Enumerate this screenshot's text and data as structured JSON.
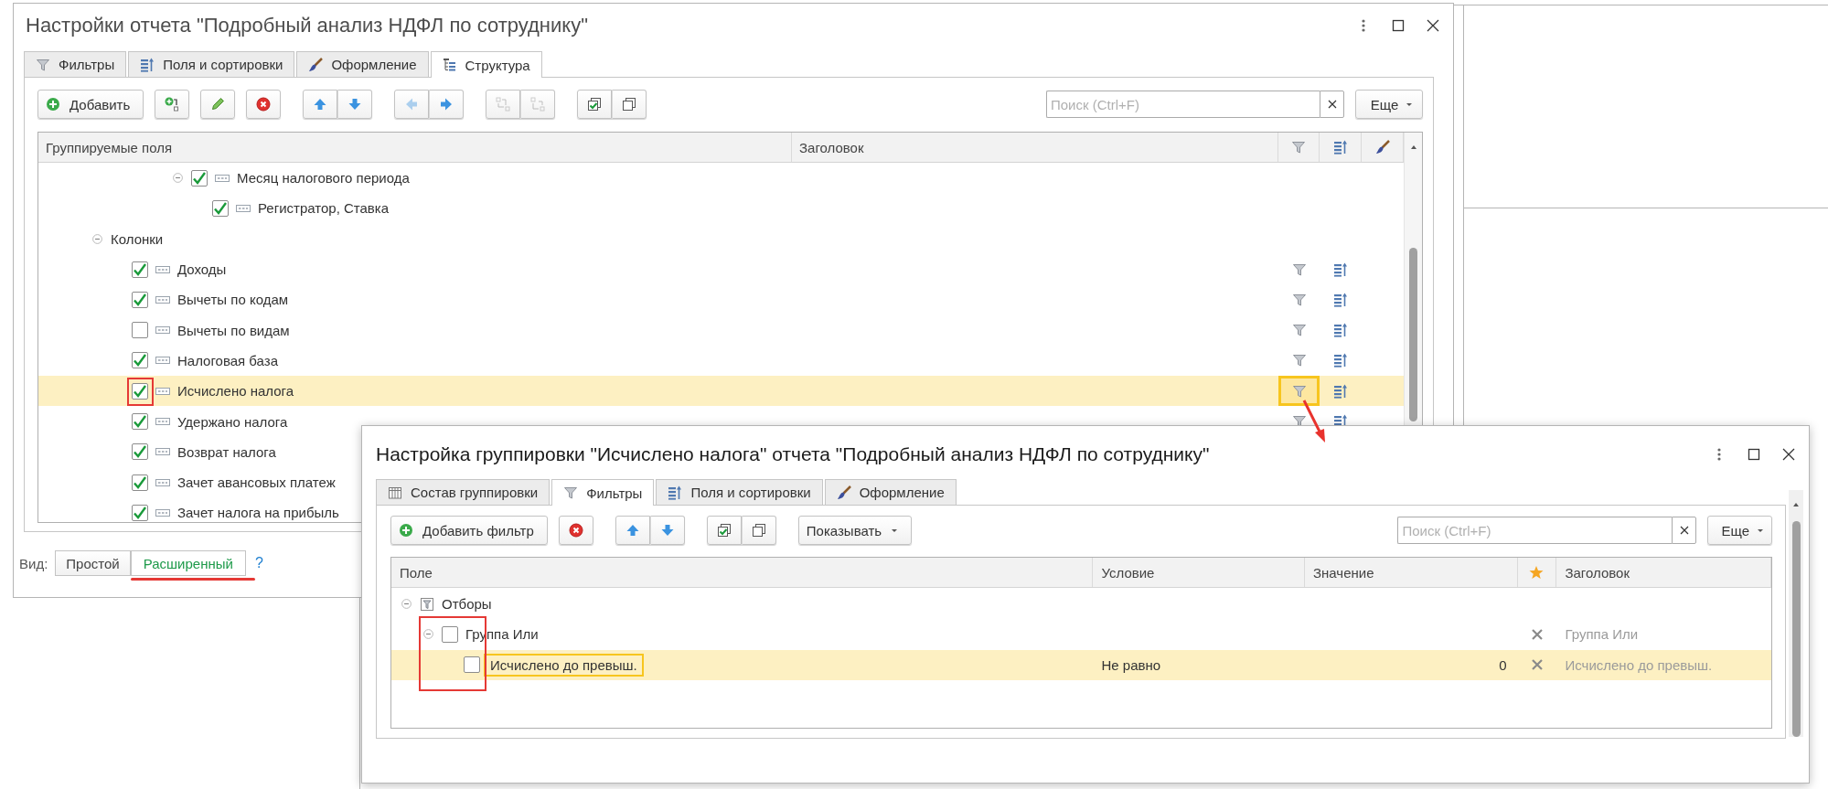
{
  "main_window": {
    "title": "Настройки отчета \"Подробный анализ НДФЛ по сотруднику\"",
    "tabs": [
      {
        "kind": "filters",
        "label": "Фильтры",
        "selected": false
      },
      {
        "kind": "fields",
        "label": "Поля и сортировки",
        "selected": false
      },
      {
        "kind": "appearance",
        "label": "Оформление",
        "selected": false
      },
      {
        "kind": "structure",
        "label": "Структура",
        "selected": true
      }
    ],
    "toolbar": [
      [
        {
          "kind": "add",
          "label": "Добавить",
          "disabled": false
        }
      ],
      [
        {
          "kind": "add-child",
          "disabled": false
        }
      ],
      [
        {
          "kind": "edit",
          "disabled": false
        }
      ],
      [
        {
          "kind": "delete",
          "disabled": false
        }
      ],
      [
        {
          "kind": "up",
          "disabled": false
        },
        {
          "kind": "down",
          "disabled": false
        }
      ],
      [
        {
          "kind": "left",
          "disabled": true
        },
        {
          "kind": "right",
          "disabled": false
        }
      ],
      [
        {
          "kind": "group",
          "disabled": true
        },
        {
          "kind": "ungroup",
          "disabled": true
        }
      ],
      [
        {
          "kind": "check-all",
          "disabled": false
        },
        {
          "kind": "uncheck-all",
          "disabled": false
        }
      ]
    ],
    "search": {
      "placeholder": "Поиск (Ctrl+F)"
    },
    "more": "Еще",
    "tree": {
      "columns": [
        {
          "kind": "text",
          "label": "Группируемые поля"
        },
        {
          "kind": "text",
          "label": "Заголовок"
        },
        {
          "kind": "filter"
        },
        {
          "kind": "sort"
        },
        {
          "kind": "brush"
        }
      ],
      "rows": [
        {
          "kind": "grouping",
          "label": "Месяц налогового периода",
          "checked": true,
          "expanded": true,
          "selected": false,
          "children": [
            {
              "kind": "grouping",
              "label": "Регистратор, Ставка",
              "checked": true,
              "selected": false
            }
          ]
        },
        {
          "kind": "section",
          "label": "Колонки",
          "expanded": true,
          "selected": false,
          "children": [
            {
              "kind": "column",
              "label": "Доходы",
              "checked": true,
              "selected": false,
              "settings_icons": true
            },
            {
              "kind": "column",
              "label": "Вычеты по кодам",
              "checked": true,
              "selected": false,
              "settings_icons": true
            },
            {
              "kind": "column",
              "label": "Вычеты по видам",
              "checked": false,
              "selected": false,
              "settings_icons": true
            },
            {
              "kind": "column",
              "label": "Налоговая база",
              "checked": true,
              "selected": false,
              "settings_icons": true
            },
            {
              "kind": "column",
              "label": "Исчислено налога",
              "checked": true,
              "selected": true,
              "settings_icons": true
            },
            {
              "kind": "column",
              "label": "Удержано налога",
              "checked": true,
              "selected": false,
              "settings_icons": true
            },
            {
              "kind": "column",
              "label": "Возврат налога",
              "checked": true,
              "selected": false,
              "settings_icons": false
            },
            {
              "kind": "column",
              "label": "Зачет авансовых платеж",
              "checked": true,
              "selected": false,
              "settings_icons": false
            },
            {
              "kind": "column",
              "label": "Зачет налога на прибыль",
              "checked": true,
              "selected": false,
              "settings_icons": false
            }
          ]
        }
      ]
    },
    "view": {
      "label": "Вид:",
      "options": [
        {
          "label": "Простой",
          "selected": false
        },
        {
          "label": "Расширенный",
          "selected": true
        }
      ],
      "help": "?"
    }
  },
  "dialog": {
    "title": "Настройка группировки \"Исчислено налога\" отчета \"Подробный анализ НДФЛ по сотруднику\"",
    "tabs": [
      {
        "kind": "composition",
        "label": "Состав группировки",
        "selected": false
      },
      {
        "kind": "filters",
        "label": "Фильтры",
        "selected": true
      },
      {
        "kind": "fields",
        "label": "Поля и сортировки",
        "selected": false
      },
      {
        "kind": "appearance",
        "label": "Оформление",
        "selected": false
      }
    ],
    "toolbar": [
      [
        {
          "kind": "add",
          "label": "Добавить фильтр",
          "disabled": false
        }
      ],
      [
        {
          "kind": "delete",
          "disabled": false
        }
      ],
      [
        {
          "kind": "up",
          "disabled": false
        },
        {
          "kind": "down",
          "disabled": false
        }
      ],
      [
        {
          "kind": "check-all",
          "disabled": false
        },
        {
          "kind": "uncheck-all",
          "disabled": false
        }
      ],
      [
        {
          "kind": "dropdown",
          "label": "Показывать"
        }
      ]
    ],
    "search": {
      "placeholder": "Поиск (Ctrl+F)"
    },
    "more": "Еще",
    "columns": [
      {
        "kind": "text",
        "label": "Поле"
      },
      {
        "kind": "text",
        "label": "Условие"
      },
      {
        "kind": "text",
        "label": "Значение"
      },
      {
        "kind": "star"
      },
      {
        "kind": "text",
        "label": "Заголовок"
      }
    ],
    "rows": [
      {
        "kind": "root",
        "label": "Отборы",
        "expanded": true,
        "selected": false,
        "children": [
          {
            "kind": "group",
            "label": "Группа Или",
            "checked": false,
            "expanded": true,
            "selected": false,
            "quick_access": false,
            "title": "Группа Или",
            "children": [
              {
                "kind": "item",
                "label": "Исчислено до превыш.",
                "checked": false,
                "selected": true,
                "quick_access": false,
                "condition": "Не равно",
                "value": "0",
                "title": "Исчислено до превыш."
              }
            ]
          }
        ]
      }
    ]
  }
}
